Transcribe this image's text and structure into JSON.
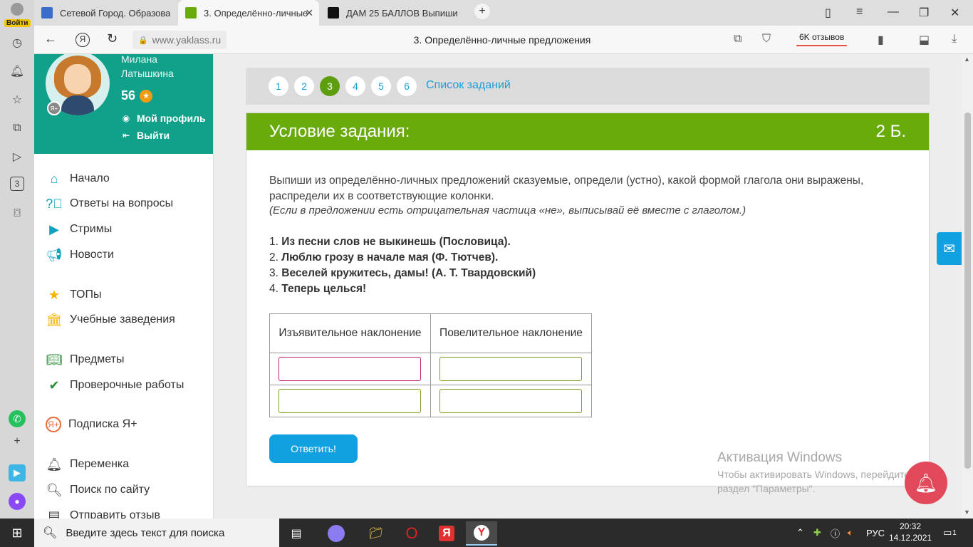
{
  "browser": {
    "tabs": [
      {
        "title": "Сетевой Город. Образова",
        "favicon_color": "#3a6cc9",
        "active": false
      },
      {
        "title": "3. Определённо-личные",
        "favicon_color": "#6aab0c",
        "active": true
      },
      {
        "title": "ДАМ 25 БАЛЛОВ Выпиши",
        "favicon_color": "#111111",
        "active": false
      }
    ],
    "login_label": "Войти",
    "url": "www.yaklass.ru",
    "page_title": "3. Определённо-личные предложения",
    "reviews_label": "6K отзывов",
    "new_tab_label": "+"
  },
  "profile": {
    "name": "Милана Латышкина",
    "score": "56",
    "profile_link": "Мой профиль",
    "logout_link": "Выйти"
  },
  "menu": [
    {
      "label": "Начало",
      "icon": "home-icon",
      "color": "#11a0c0"
    },
    {
      "label": "Ответы на вопросы",
      "icon": "question-icon",
      "color": "#11a0c0"
    },
    {
      "label": "Стримы",
      "icon": "stream-icon",
      "color": "#11a0c0"
    },
    {
      "label": "Новости",
      "icon": "megaphone-icon",
      "color": "#11a0c0"
    },
    {
      "label": "ТОПы",
      "icon": "star-icon",
      "color": "#f5b400"
    },
    {
      "label": "Учебные заведения",
      "icon": "institution-icon",
      "color": "#f5b400"
    },
    {
      "label": "Предметы",
      "icon": "book-icon",
      "color": "#2e8b3a"
    },
    {
      "label": "Проверочные работы",
      "icon": "check-circle-icon",
      "color": "#2e8b3a"
    },
    {
      "label": "Подписка Я+",
      "icon": "ya-plus-icon",
      "color": "#e56a3c"
    },
    {
      "label": "Переменка",
      "icon": "bell-icon",
      "color": "#444444"
    },
    {
      "label": "Поиск по сайту",
      "icon": "search-icon",
      "color": "#444444"
    },
    {
      "label": "Отправить отзыв",
      "icon": "feedback-icon",
      "color": "#444444"
    }
  ],
  "pager": {
    "pages": [
      "1",
      "2",
      "3",
      "4",
      "5",
      "6"
    ],
    "active_page": "3",
    "task_list_label": "Список заданий"
  },
  "task": {
    "header": "Условие задания:",
    "points": "2 Б.",
    "instruction": "Выпиши из определённо-личных предложений сказуемые, определи (устно), какой формой глагола они выражены, распредели их в соответствующие колонки.",
    "note": "(Если в предложении есть отрицательная частица «не», выписывай её вместе с глаголом.)",
    "sentences": [
      {
        "num": "1.",
        "text": "Из песни слов не выкинешь (Пословица)."
      },
      {
        "num": "2.",
        "text": "Люблю грозу в начале мая (Ф. Тютчев)."
      },
      {
        "num": "3.",
        "text": "Веселей кружитесь, дамы! (А. Т. Твардовский)"
      },
      {
        "num": "4.",
        "text": "Теперь целься!"
      }
    ],
    "table": {
      "col1": "Изъявительное наклонение",
      "col2": "Повелительное наклонение",
      "rows": [
        [
          "",
          ""
        ],
        [
          "",
          ""
        ]
      ]
    },
    "submit_label": "Ответить!"
  },
  "watermark": {
    "title": "Активация Windows",
    "line1": "Чтобы активировать Windows, перейдите в",
    "line2": "раздел \"Параметры\"."
  },
  "taskbar": {
    "search_placeholder": "Введите здесь текст для поиска",
    "language": "РУС",
    "time": "20:32",
    "date": "14.12.2021",
    "notifications": "1"
  }
}
